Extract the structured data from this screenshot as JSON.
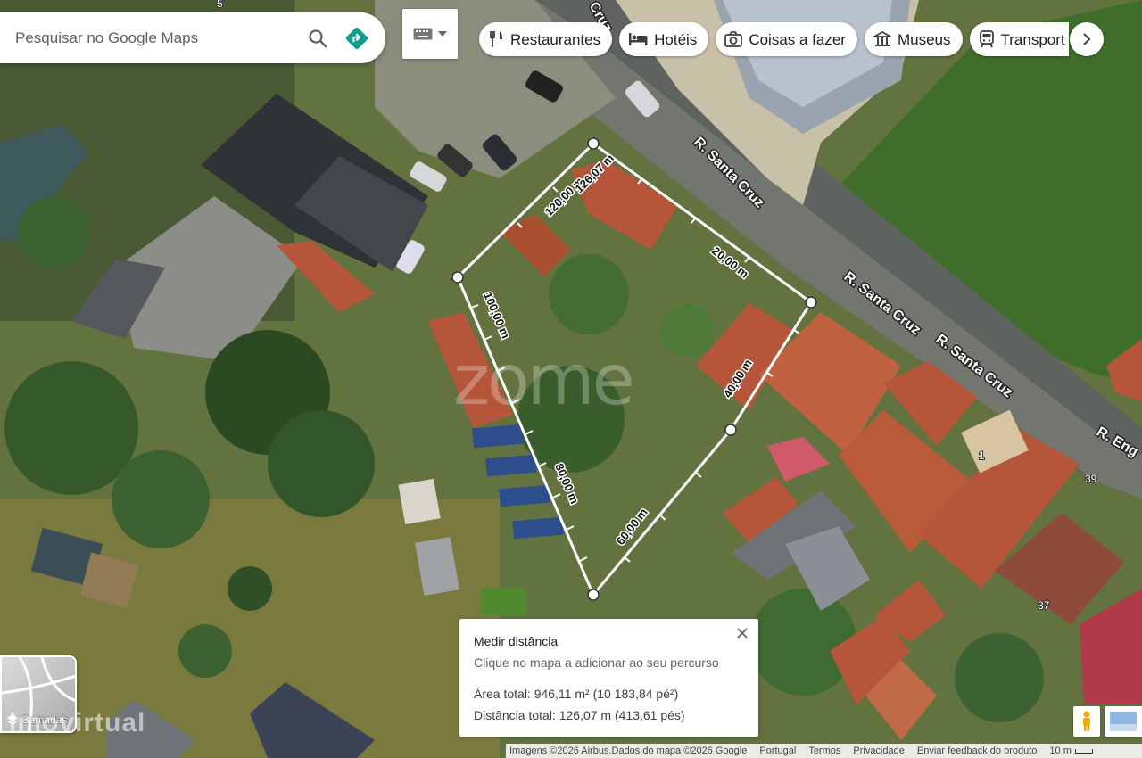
{
  "search": {
    "placeholder": "Pesquisar no Google Maps"
  },
  "categories": [
    {
      "label": "Restaurantes",
      "icon": "fork-knife-icon"
    },
    {
      "label": "Hotéis",
      "icon": "bed-icon"
    },
    {
      "label": "Coisas a fazer",
      "icon": "camera-icon"
    },
    {
      "label": "Museus",
      "icon": "museum-icon"
    },
    {
      "label": "Transport",
      "icon": "train-icon"
    }
  ],
  "map": {
    "roads": [
      {
        "label": "R. Santa Cruz"
      },
      {
        "label": "R. Santa Cruz"
      },
      {
        "label": "R. Santa Cruz"
      },
      {
        "label": "R. Eng"
      },
      {
        "label": "Cruz"
      }
    ],
    "segments": [
      {
        "label": "120,00 m"
      },
      {
        "label": "126,07 m"
      },
      {
        "label": "20,00 m"
      },
      {
        "label": "40,00 m"
      },
      {
        "label": "60,00 m"
      },
      {
        "label": "80,00 m"
      },
      {
        "label": "100,00 m"
      }
    ],
    "house_numbers": [
      "5",
      "1",
      "39",
      "37"
    ]
  },
  "watermarks": {
    "overlay": "zome",
    "corner": "imovirtual"
  },
  "measure": {
    "title": "Medir distância",
    "hint": "Clique no mapa a adicionar ao seu percurso",
    "area": "Área total: 946,11 m² (10 183,84 pé²)",
    "distance": "Distância total: 126,07 m (413,61 pés)"
  },
  "layers": {
    "label": "Camadas"
  },
  "footer": {
    "attribution": "Imagens ©2026 Airbus,Dados do mapa ©2026 Google",
    "country": "Portugal",
    "terms": "Termos",
    "privacy": "Privacidade",
    "feedback": "Enviar feedback do produto",
    "scale": "10 m"
  },
  "colors": {
    "accent": "#1a73e8",
    "directions": "#0f9d8c",
    "measure_line": "#ffffff",
    "roof": "#b5553a"
  }
}
